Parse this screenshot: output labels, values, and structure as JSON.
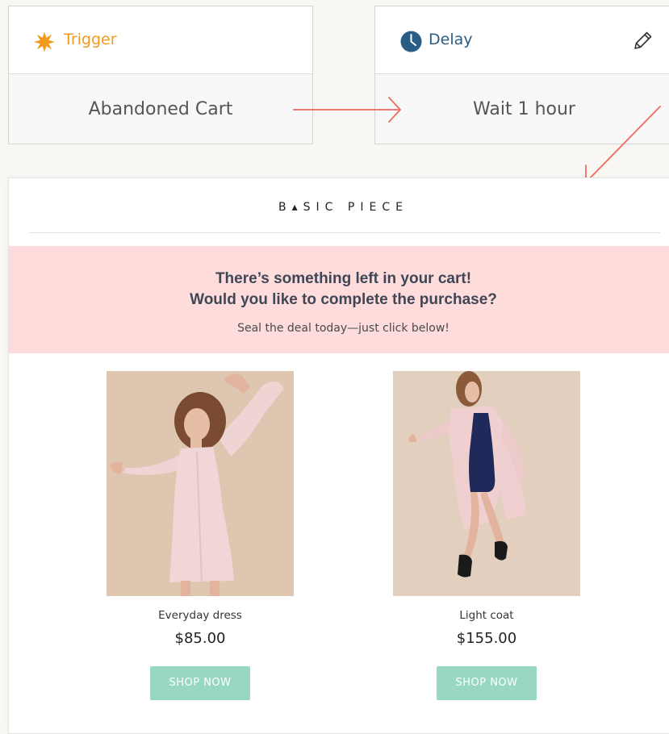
{
  "workflow": {
    "trigger": {
      "label": "Trigger",
      "value": "Abandoned Cart",
      "icon": "starburst-icon",
      "color": "#f29a1e"
    },
    "delay": {
      "label": "Delay",
      "value": "Wait 1 hour",
      "icon": "clock-icon",
      "color": "#2a5d86",
      "edit_icon": "pencil-icon"
    },
    "connector_color": "#f06a5f"
  },
  "email": {
    "brand": "B▴SIC PIECE",
    "banner": {
      "line1": "There’s something left in your cart!",
      "line2": "Would you like to complete the purchase?",
      "subline": "Seal the deal today—just click below!",
      "color": "#fedcdc"
    },
    "products": [
      {
        "name": "Everyday dress",
        "price": "$85.00",
        "button": "SHOP NOW"
      },
      {
        "name": "Light coat",
        "price": "$155.00",
        "button": "SHOP NOW"
      }
    ],
    "button_color": "#97d7c3"
  }
}
